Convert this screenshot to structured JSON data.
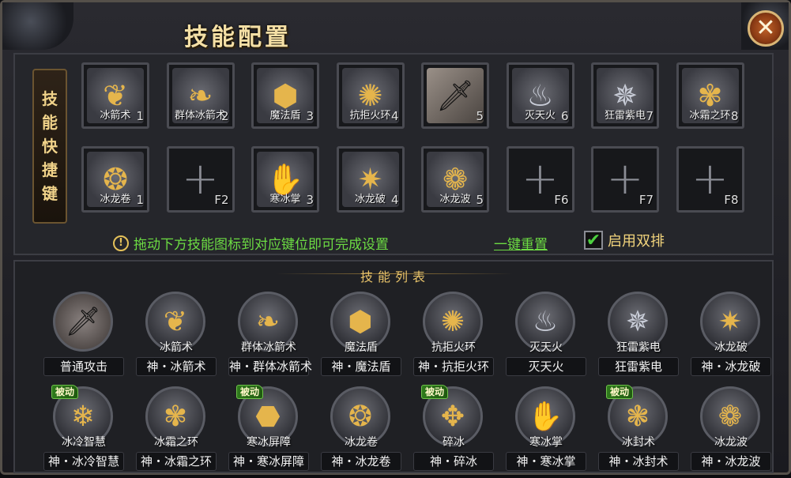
{
  "window": {
    "title": "技能配置",
    "close_glyph": "✕"
  },
  "side_label": [
    "技",
    "能",
    "快",
    "捷",
    "键"
  ],
  "slots_row1": [
    {
      "name": "冰箭术",
      "key": "1",
      "icon": "feather-arrow-icon",
      "glyph": "❦",
      "style": "gold"
    },
    {
      "name": "群体冰箭术",
      "key": "2",
      "icon": "multi-feather-icon",
      "glyph": "❧",
      "style": "gold"
    },
    {
      "name": "魔法盾",
      "key": "3",
      "icon": "shield-icon",
      "glyph": "⬢",
      "style": "gold"
    },
    {
      "name": "抗拒火环",
      "key": "4",
      "icon": "fire-ring-icon",
      "glyph": "✺",
      "style": "gold"
    },
    {
      "name": "",
      "key": "5",
      "icon": "sword-icon",
      "glyph": "🗡",
      "style": "sword"
    },
    {
      "name": "灭天火",
      "key": "6",
      "icon": "flame-icon",
      "glyph": "♨",
      "style": "silver"
    },
    {
      "name": "狂雷紫电",
      "key": "7",
      "icon": "lightning-orb-icon",
      "glyph": "✵",
      "style": "silver"
    },
    {
      "name": "冰霜之环",
      "key": "8",
      "icon": "frost-ring-icon",
      "glyph": "✾",
      "style": "gold"
    }
  ],
  "slots_row2": [
    {
      "name": "冰龙卷",
      "key": "1",
      "icon": "tornado-icon",
      "glyph": "❂",
      "style": "gold"
    },
    {
      "name": "",
      "key": "F2",
      "icon": "plus-icon",
      "empty": true
    },
    {
      "name": "寒冰掌",
      "key": "3",
      "icon": "palm-icon",
      "glyph": "✋",
      "style": "gold"
    },
    {
      "name": "冰龙破",
      "key": "4",
      "icon": "ice-burst-icon",
      "glyph": "✷",
      "style": "gold"
    },
    {
      "name": "冰龙波",
      "key": "5",
      "icon": "dragon-wave-icon",
      "glyph": "❁",
      "style": "gold"
    },
    {
      "name": "",
      "key": "F6",
      "icon": "plus-icon",
      "empty": true
    },
    {
      "name": "",
      "key": "F7",
      "icon": "plus-icon",
      "empty": true
    },
    {
      "name": "",
      "key": "F8",
      "icon": "plus-icon",
      "empty": true
    }
  ],
  "plus_glyph": "+",
  "hint": {
    "icon_glyph": "!",
    "text": "拖动下方技能图标到对应键位即可完成设置"
  },
  "reset_label": "一键重置",
  "double_row": {
    "label": "启用双排",
    "checked": true,
    "check_glyph": "✔"
  },
  "list_title": "技能列表",
  "skills_row1": [
    {
      "name": "",
      "sub": "普通攻击",
      "icon": "sword-icon",
      "glyph": "🗡",
      "style": "sword"
    },
    {
      "name": "冰箭术",
      "sub": "神・冰箭术",
      "icon": "feather-arrow-icon",
      "glyph": "❦",
      "style": "gold"
    },
    {
      "name": "群体冰箭术",
      "sub": "神・群体冰箭术",
      "icon": "multi-feather-icon",
      "glyph": "❧",
      "style": "gold"
    },
    {
      "name": "魔法盾",
      "sub": "神・魔法盾",
      "icon": "shield-icon",
      "glyph": "⬢",
      "style": "gold"
    },
    {
      "name": "抗拒火环",
      "sub": "神・抗拒火环",
      "icon": "fire-ring-icon",
      "glyph": "✺",
      "style": "gold"
    },
    {
      "name": "灭天火",
      "sub": "灭天火",
      "icon": "flame-icon",
      "glyph": "♨",
      "style": "silver"
    },
    {
      "name": "狂雷紫电",
      "sub": "狂雷紫电",
      "icon": "lightning-orb-icon",
      "glyph": "✵",
      "style": "silver"
    },
    {
      "name": "冰龙破",
      "sub": "神・冰龙破",
      "icon": "ice-burst-icon",
      "glyph": "✷",
      "style": "gold"
    }
  ],
  "skills_row2": [
    {
      "name": "冰冷智慧",
      "sub": "神・冰冷智慧",
      "icon": "snowflake-moon-icon",
      "glyph": "❄",
      "style": "gold",
      "passive": "被动"
    },
    {
      "name": "冰霜之环",
      "sub": "神・冰霜之环",
      "icon": "frost-ring-icon",
      "glyph": "✾",
      "style": "gold"
    },
    {
      "name": "寒冰屏障",
      "sub": "神・寒冰屏障",
      "icon": "turtle-shell-icon",
      "glyph": "⬣",
      "style": "gold",
      "passive": "被动"
    },
    {
      "name": "冰龙卷",
      "sub": "神・冰龙卷",
      "icon": "tornado-icon",
      "glyph": "❂",
      "style": "gold"
    },
    {
      "name": "碎冰",
      "sub": "神・碎冰",
      "icon": "shatter-icon",
      "glyph": "✥",
      "style": "gold",
      "passive": "被动"
    },
    {
      "name": "寒冰掌",
      "sub": "神・寒冰掌",
      "icon": "palm-icon",
      "glyph": "✋",
      "style": "gold"
    },
    {
      "name": "冰封术",
      "sub": "神・冰封术",
      "icon": "ice-seal-icon",
      "glyph": "❃",
      "style": "gold",
      "passive": "被动"
    },
    {
      "name": "冰龙波",
      "sub": "神・冰龙波",
      "icon": "dragon-wave-icon",
      "glyph": "❁",
      "style": "gold"
    }
  ],
  "colors": {
    "accent_gold": "#e5b54c",
    "hint_green": "#6cdb43",
    "label_gold": "#f2d47c",
    "passive_green": "#2f7a1c"
  }
}
